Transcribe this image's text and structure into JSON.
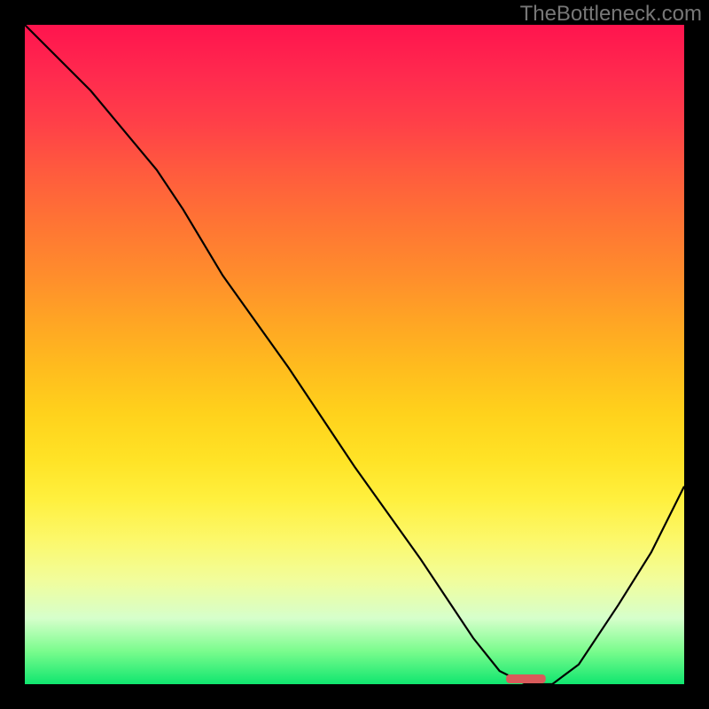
{
  "watermark": "TheBottleneck.com",
  "chart_data": {
    "type": "line",
    "title": "",
    "xlabel": "",
    "ylabel": "",
    "xlim": [
      0,
      100
    ],
    "ylim": [
      0,
      100
    ],
    "grid": false,
    "legend": false,
    "series": [
      {
        "name": "curve",
        "x": [
          0,
          10,
          20,
          24,
          30,
          40,
          50,
          60,
          68,
          72,
          76,
          80,
          84,
          90,
          95,
          100
        ],
        "y": [
          100,
          90,
          78,
          72,
          62,
          48,
          33,
          19,
          7,
          2,
          0,
          0,
          3,
          12,
          20,
          30
        ]
      }
    ],
    "marker": {
      "x": 76,
      "y": 0,
      "width": 6,
      "color": "#d85a5a"
    },
    "gradient_stops": [
      {
        "pos": 0,
        "color": "#ff144e"
      },
      {
        "pos": 50,
        "color": "#ffc21e"
      },
      {
        "pos": 80,
        "color": "#fcf86a"
      },
      {
        "pos": 100,
        "color": "#10e66f"
      }
    ]
  }
}
